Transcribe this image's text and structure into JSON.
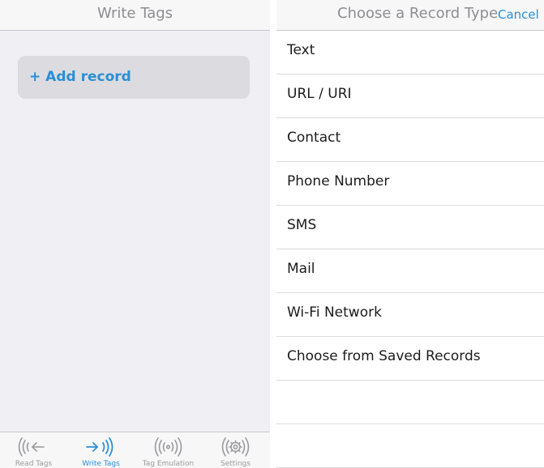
{
  "write_tags": {
    "title": "Write Tags",
    "add_record_label": "+ Add record"
  },
  "tabbar": {
    "tabs": [
      {
        "label": "Read Tags",
        "icon": "read-tags-icon",
        "active": false
      },
      {
        "label": "Write Tags",
        "icon": "write-tags-icon",
        "active": true
      },
      {
        "label": "Tag Emulation",
        "icon": "tag-emulation-icon",
        "active": false
      },
      {
        "label": "Settings",
        "icon": "settings-gear-icon",
        "active": false
      }
    ]
  },
  "record_type": {
    "title": "Choose a Record Type",
    "cancel_label": "Cancel",
    "items": [
      {
        "label": "Text"
      },
      {
        "label": "URL / URI"
      },
      {
        "label": "Contact"
      },
      {
        "label": "Phone Number"
      },
      {
        "label": "SMS"
      },
      {
        "label": "Mail"
      },
      {
        "label": "Wi-Fi Network"
      },
      {
        "label": "Choose from Saved Records"
      }
    ]
  },
  "colors": {
    "accent": "#2a8fd6",
    "header_bg": "#f7f7f7",
    "screen_bg": "#efeff4",
    "title_gray": "#8e8e93"
  }
}
